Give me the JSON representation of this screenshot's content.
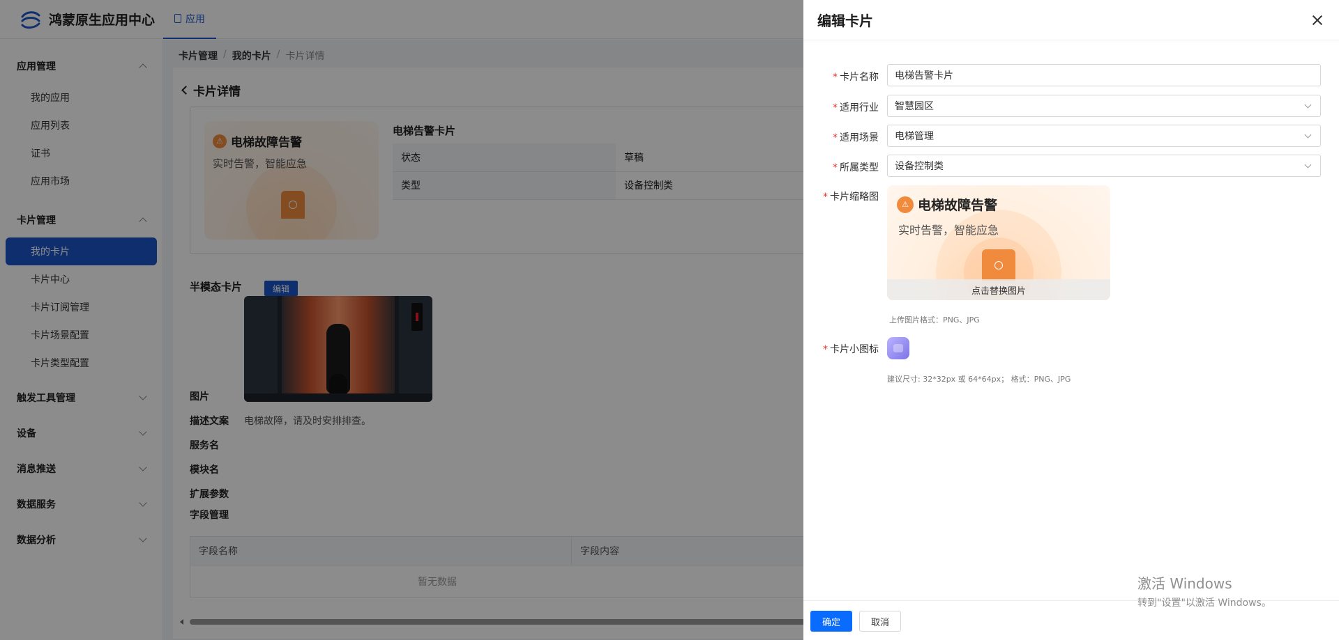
{
  "app": {
    "brand": "鸿蒙原生应用中心",
    "top_tab": "应用"
  },
  "sidebar": {
    "groups": [
      {
        "label": "应用管理",
        "expanded": true,
        "items": [
          "我的应用",
          "应用列表",
          "证书",
          "应用市场"
        ]
      },
      {
        "label": "卡片管理",
        "expanded": true,
        "items": [
          "我的卡片",
          "卡片中心",
          "卡片订阅管理",
          "卡片场景配置",
          "卡片类型配置"
        ]
      },
      {
        "label": "触发工具管理",
        "expanded": false
      },
      {
        "label": "设备",
        "expanded": false
      },
      {
        "label": "消息推送",
        "expanded": false
      },
      {
        "label": "数据服务",
        "expanded": false
      },
      {
        "label": "数据分析",
        "expanded": false
      }
    ],
    "active_item": "我的卡片"
  },
  "breadcrumb": [
    "卡片管理",
    "我的卡片",
    "卡片详情"
  ],
  "detail": {
    "title": "卡片详情",
    "card_preview": {
      "title": "电梯故障告警",
      "subtitle": "实时告警，智能应急"
    },
    "card_name": "电梯告警卡片",
    "info_rows": [
      {
        "key": "状态",
        "value": "草稿"
      },
      {
        "key": "类型",
        "value": "设备控制类"
      }
    ],
    "half_modal": {
      "title": "半模态卡片",
      "edit_label": "编辑",
      "labels": {
        "image": "图片",
        "description": "描述文案",
        "service": "服务名",
        "module": "模块名",
        "ext": "扩展参数",
        "fields": "字段管理"
      },
      "description_value": "电梯故障，请及时安排排查。"
    },
    "fields_table": {
      "headers": [
        "字段名称",
        "字段内容"
      ],
      "empty_text": "暂无数据"
    }
  },
  "drawer": {
    "title": "编辑卡片",
    "fields": {
      "card_name": {
        "label": "卡片名称",
        "value": "电梯告警卡片"
      },
      "industry": {
        "label": "适用行业",
        "value": "智慧园区"
      },
      "scene": {
        "label": "适用场景",
        "value": "电梯管理"
      },
      "type": {
        "label": "所属类型",
        "value": "设备控制类"
      },
      "thumbnail": {
        "label": "卡片缩略图",
        "preview_title": "电梯故障告警",
        "preview_subtitle": "实时告警，智能应急",
        "replace_text": "点击替换图片",
        "hint": "上传图片格式：PNG、JPG"
      },
      "icon": {
        "label": "卡片小图标",
        "hint": "建议尺寸: 32*32px 或 64*64px；  格式：PNG、JPG"
      }
    },
    "ok_label": "确定",
    "cancel_label": "取消"
  },
  "watermark": {
    "line1": "激活 Windows",
    "line2": "转到\"设置\"以激活 Windows。"
  },
  "colors": {
    "brand_blue": "#1a55c8",
    "primary_button": "#0a6cff",
    "required": "#e8352f",
    "card_accent": "#f08a3c"
  }
}
